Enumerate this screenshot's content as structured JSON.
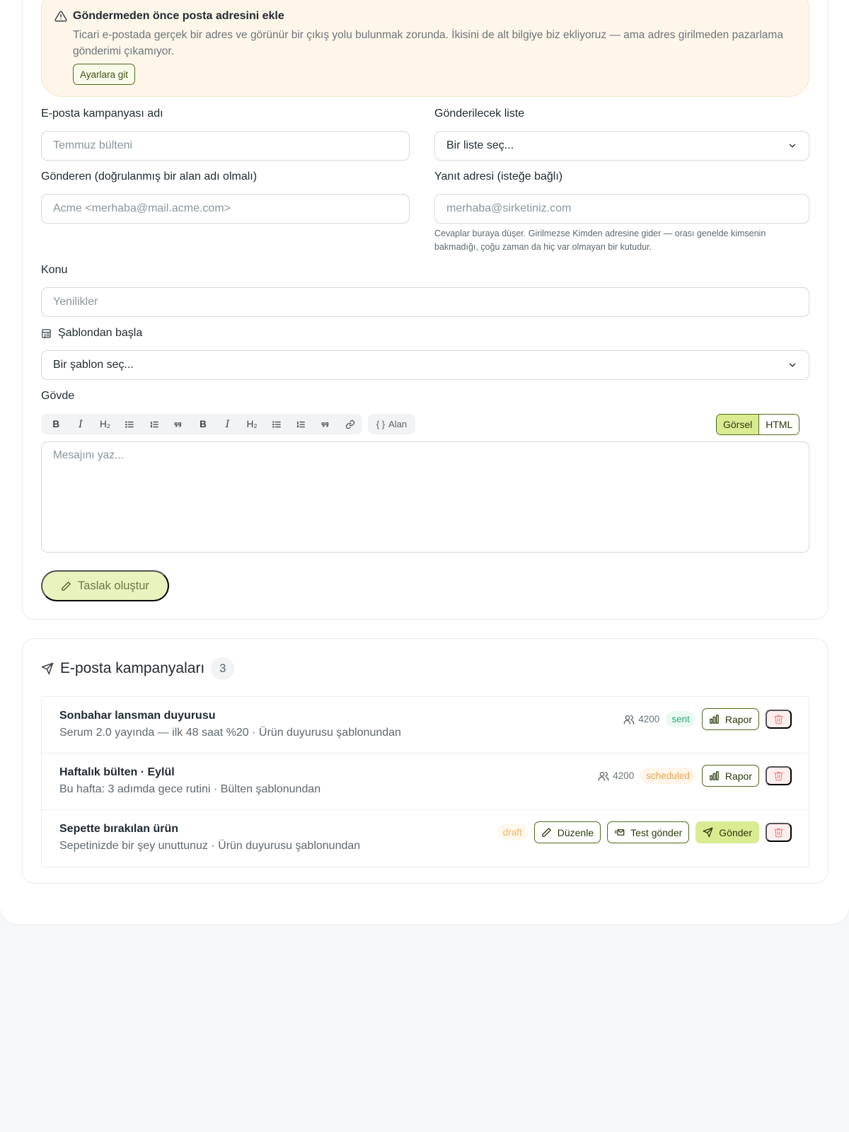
{
  "alert": {
    "title": "Göndermeden önce posta adresini ekle",
    "body": "Ticari e-postada gerçek bir adres ve görünür bir çıkış yolu bulunmak zorunda. İkisini de alt bilgiye biz ekliyoruz — ama adres girilmeden pazarlama gönderimi çıkamıyor.",
    "button": "Ayarlara git",
    "icon": "warning-icon"
  },
  "form": {
    "campaign_name_label": "E-posta kampanyası adı",
    "campaign_name_placeholder": "Temmuz bülteni",
    "list_label": "Gönderilecek liste",
    "list_value": "Bir liste seç...",
    "sender_label": "Gönderen (doğrulanmış bir alan adı olmalı)",
    "sender_placeholder": "Acme <merhaba@mail.acme.com>",
    "reply_label": "Yanıt adresi (isteğe bağlı)",
    "reply_placeholder": "merhaba@sirketiniz.com",
    "reply_help": "Cevaplar buraya düşer. Girilmezse Kimden adresine gider — orası genelde kimsenin bakmadığı, çoğu zaman da hiç var olmayan bir kutudur.",
    "subject_label": "Konu",
    "subject_placeholder": "Yenilikler",
    "template_label": "Şablondan başla",
    "template_value": "Bir şablon seç...",
    "body_label": "Gövde",
    "body_placeholder": "Mesajını yaz...",
    "field_button": "Alan",
    "mode_visual": "Görsel",
    "mode_html": "HTML",
    "draft_button": "Taslak oluştur"
  },
  "toolbar": {
    "group1": [
      "B",
      "I",
      "H₂",
      "bullet-list-icon",
      "ordered-list-icon",
      "quote-icon"
    ],
    "group2": [
      "B",
      "I",
      "H₂",
      "bullet-list-icon",
      "ordered-list-icon",
      "quote-icon",
      "link-icon"
    ]
  },
  "campaigns": {
    "title": "E-posta kampanyaları",
    "count": "3",
    "rows": [
      {
        "title": "Sonbahar lansman duyurusu",
        "subtitle": "Serum 2.0 yayında — ilk 48 saat %20 · Ürün duyurusu şablonundan",
        "audience": "4200",
        "status": "sent",
        "report": "Rapor"
      },
      {
        "title": "Haftalık bülten · Eylül",
        "subtitle": "Bu hafta: 3 adımda gece rutini · Bülten şablonundan",
        "audience": "4200",
        "status": "scheduled",
        "report": "Rapor"
      },
      {
        "title": "Sepette bırakılan ürün",
        "subtitle": "Sepetinizde bir şey unuttunuz · Ürün duyurusu şablonundan",
        "status": "draft",
        "edit": "Düzenle",
        "test": "Test gönder",
        "send": "Gönder"
      }
    ]
  },
  "colors": {
    "accent": "#d9ec92",
    "accent_border": "#4f6a1b",
    "sent": "#2dab79",
    "scheduled": "#f0a247",
    "draft": "#f2b469",
    "delete": "#f08a8a"
  }
}
